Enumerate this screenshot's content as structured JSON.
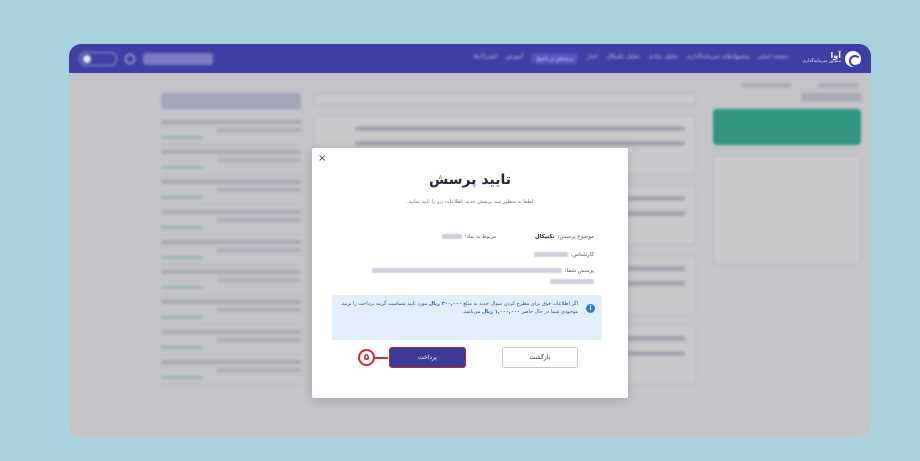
{
  "app": {
    "brand_name": "آوا",
    "brand_tagline": "مشاور سرمایه‌گذاری"
  },
  "navbar": {
    "items": [
      {
        "label": "صفحه اصلی"
      },
      {
        "label": "پیشنهادهای سرمایه‌گذاری"
      },
      {
        "label": "تحلیل بنیادی"
      },
      {
        "label": "تحلیل تکنیکال"
      },
      {
        "label": "اخبار"
      },
      {
        "label": "پرسش و پاسخ"
      },
      {
        "label": "آموزش"
      },
      {
        "label": "اشتراک‌ها"
      }
    ]
  },
  "modal": {
    "title": "تایید پرسش",
    "subtitle": "لطفا به منظور ثبت پرسش جدید، اطلاعات زیر را تایید نمایید.",
    "subject_label": "موضوع پرسش:",
    "subject_value": "تکنیکال",
    "linked_label": "مربوط به نماد:",
    "expert_label": "کارشناس:",
    "question_label": "پرسش شما:",
    "alert_part1": "اگر اطلاعات فوق برای مطرح کردن سوال جدید به مبلغ",
    "alert_amount": "۳۰۰,۰۰۰ ریال",
    "alert_part2": "مورد تایید شماست گزینه پرداخت را بزنید. موجودی شما در حال حاضر",
    "alert_balance": "۱,۰۰۰,۰۰۰ ریال",
    "alert_part3": "می‌باشد.",
    "info_icon": "i",
    "back_label": "بازگشت",
    "pay_label": "پرداخت",
    "close_label": "×"
  },
  "annotation": {
    "step_number": "۵",
    "color": "#d62a32"
  },
  "colors": {
    "navbar": "#3d3fa3",
    "primary_button": "#3b3b96",
    "green_button": "#16b08e",
    "alert_bg": "#e2effb"
  }
}
